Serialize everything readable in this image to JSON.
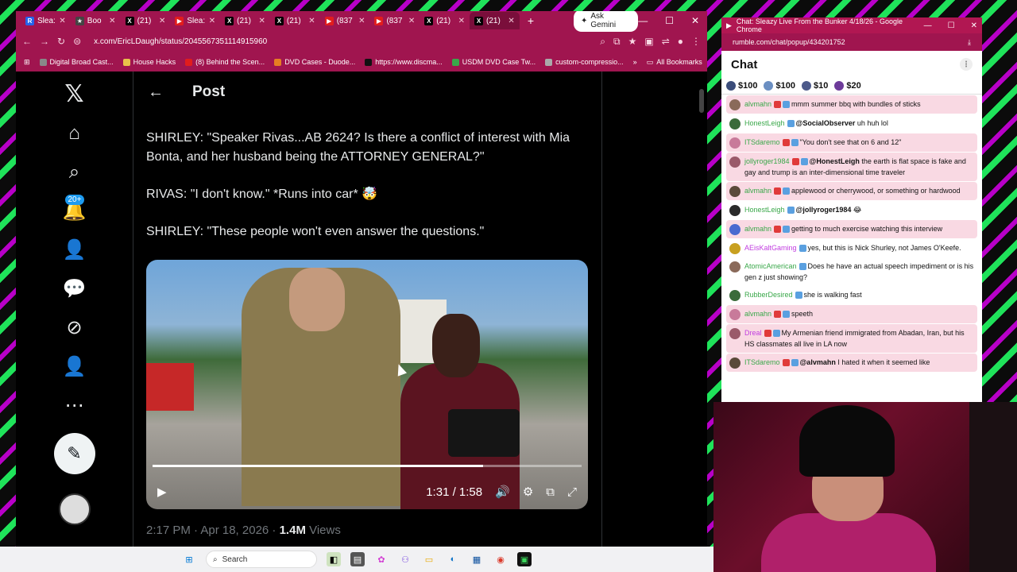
{
  "browser": {
    "tabs": [
      {
        "label": "Slea:",
        "icon": "R"
      },
      {
        "label": "Boo",
        "icon": "★"
      },
      {
        "label": "(21)",
        "icon": "X"
      },
      {
        "label": "Slea:",
        "icon": "▶"
      },
      {
        "label": "(21)",
        "icon": "X"
      },
      {
        "label": "(21)",
        "icon": "X"
      },
      {
        "label": "(837",
        "icon": "▶"
      },
      {
        "label": "(837",
        "icon": "▶"
      },
      {
        "label": "(21)",
        "icon": "X"
      },
      {
        "label": "(21)",
        "icon": "X"
      }
    ],
    "ask_gemini": "Ask Gemini",
    "url": "x.com/EricLDaugh/status/2045567351114915960",
    "bookmarks": [
      "Digital Broad Cast...",
      "House Hacks",
      "(8) Behind the Scen...",
      "DVD Cases - Duode...",
      "https://www.discma...",
      "USDM DVD Case Tw...",
      "custom-compressio..."
    ],
    "all_bookmarks": "All Bookmarks"
  },
  "x": {
    "header_title": "Post",
    "notif_badge": "20+",
    "paragraphs": [
      "SHIRLEY: \"Speaker Rivas...AB 2624? Is there a conflict of interest with Mia Bonta, and her husband being the ATTORNEY GENERAL?\"",
      "RIVAS: \"I don't know.\" *Runs into car* 🤯",
      "SHIRLEY: \"These people won't even answer the questions.\""
    ],
    "video_time": "1:31 / 1:58",
    "video_progress": 0.77,
    "post_time": "2:17 PM · Apr 18, 2026 · ",
    "views_count": "1.4M",
    "views_label": " Views"
  },
  "chat": {
    "window_title": "Chat: Sleazy Live From the Bunker 4/18/26 - Google Chrome",
    "url": "rumble.com/chat/popup/434201752",
    "heading": "Chat",
    "rants": [
      "$100",
      "$100",
      "$10",
      "$20"
    ],
    "messages": [
      {
        "user": "alvmahn",
        "mention": "",
        "text": "mmm summer bbq with bundles of sticks",
        "color": "#3aa84a",
        "pink": true
      },
      {
        "user": "HonestLeigh",
        "mention": "@SocialObserver",
        "text": " uh huh lol",
        "color": "#3aa84a",
        "pink": false
      },
      {
        "user": "ITSdaremo",
        "mention": "",
        "text": "\"You don't see that on 6 and 12\"",
        "color": "#3aa84a",
        "pink": true
      },
      {
        "user": "jollyroger1984",
        "mention": "@HonestLeigh",
        "text": " the earth is flat space is fake and gay and trump is an inter-dimensional time traveler",
        "color": "#3aa84a",
        "pink": true
      },
      {
        "user": "alvmahn",
        "mention": "",
        "text": "applewood or cherrywood, or something or hardwood",
        "color": "#3aa84a",
        "pink": true
      },
      {
        "user": "HonestLeigh",
        "mention": "@jollyroger1984",
        "text": " 😂",
        "color": "#3aa84a",
        "pink": false
      },
      {
        "user": "alvmahn",
        "mention": "",
        "text": "getting to much exercise watching this interview",
        "color": "#3aa84a",
        "pink": true
      },
      {
        "user": "AEisKaltGaming",
        "mention": "",
        "text": "yes, but this is Nick Shurley, not James O'Keefe.",
        "color": "#c13de0",
        "pink": false
      },
      {
        "user": "AtomicAmerican",
        "mention": "",
        "text": "Does he have an actual speech impediment or is his gen z just showing?",
        "color": "#3aa84a",
        "pink": false
      },
      {
        "user": "RubberDesired",
        "mention": "",
        "text": "she is walking fast",
        "color": "#3aa84a",
        "pink": false
      },
      {
        "user": "alvmahn",
        "mention": "",
        "text": "speeth",
        "color": "#3aa84a",
        "pink": true
      },
      {
        "user": "Dreal",
        "mention": "",
        "text": "My Armenian friend immigrated from Abadan, Iran, but his HS classmates all live in LA now",
        "color": "#c13de0",
        "pink": true
      },
      {
        "user": "ITSdaremo",
        "mention": "@alvmahn",
        "text": " I hated it when it seemed like",
        "color": "#3aa84a",
        "pink": true
      }
    ]
  },
  "taskbar": {
    "search": "Search"
  }
}
